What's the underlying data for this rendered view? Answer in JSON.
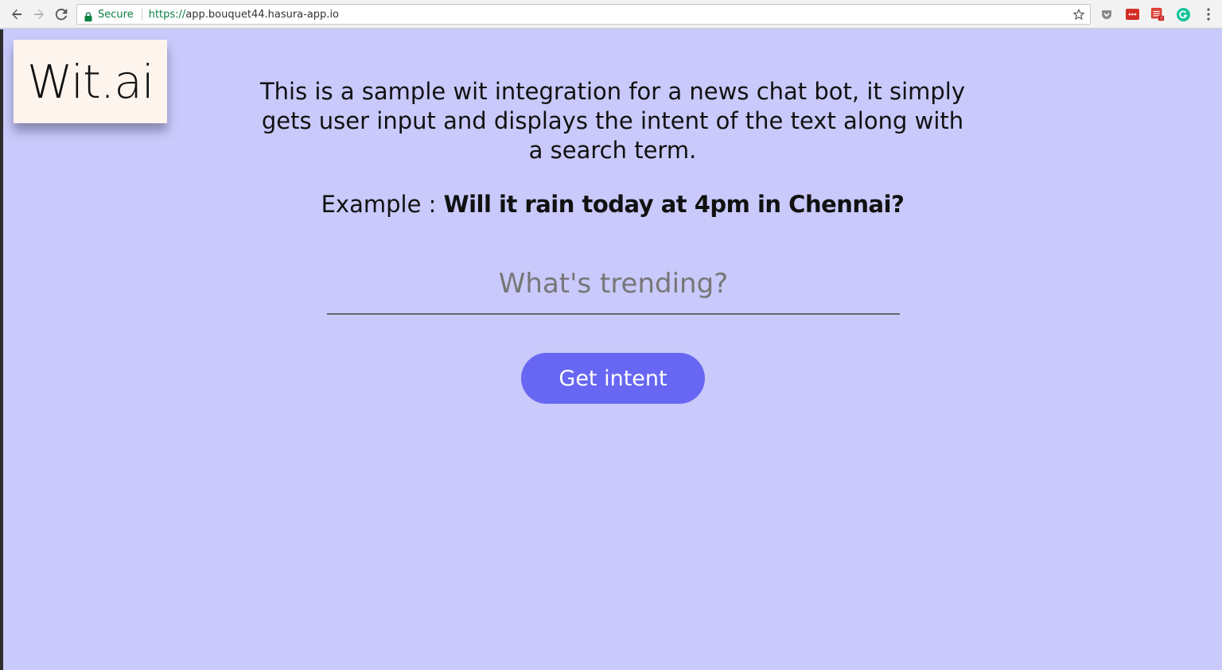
{
  "browser": {
    "secure_label": "Secure",
    "url_scheme": "https://",
    "url_host": "app.bouquet44.hasura-app.io"
  },
  "logo": {
    "text": "Wit.ai"
  },
  "intro": {
    "line1": "This is a sample wit integration for a news chat bot, it simply",
    "line2": "gets user input and displays the intent of the text along with",
    "line3": "a search term."
  },
  "example": {
    "label": "Example :",
    "value": "Will it rain today at 4pm in Chennai?"
  },
  "search": {
    "placeholder": "What's trending?",
    "value": ""
  },
  "button": {
    "label": "Get intent"
  },
  "colors": {
    "page_background": "#c9c9fb",
    "button": "#6767f3",
    "logo_card": "#fdf4ee",
    "secure_green": "#0b8043"
  }
}
